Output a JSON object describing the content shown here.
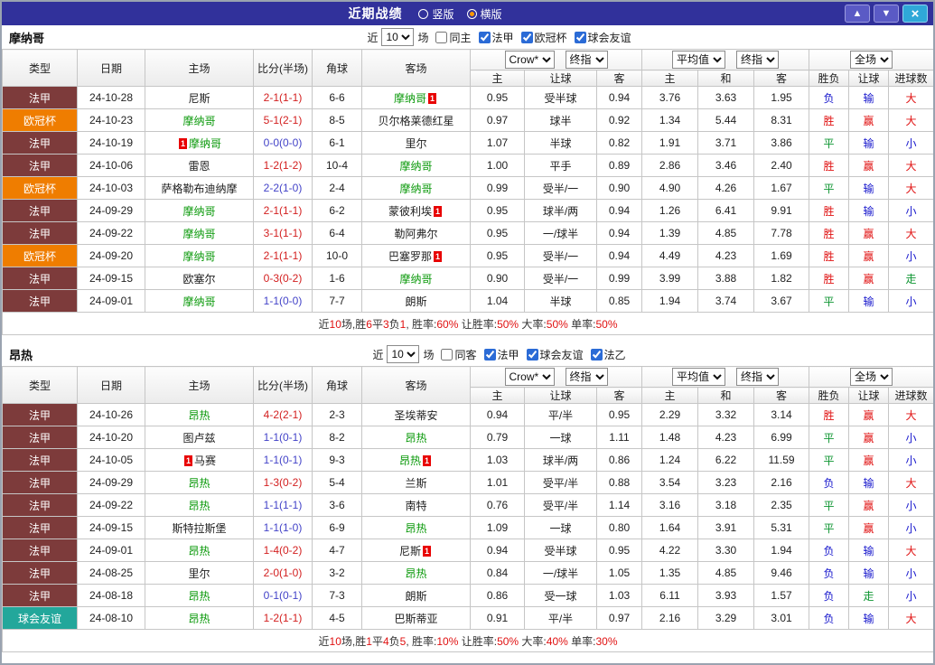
{
  "palette": {
    "leagues": {
      "法甲": "#7d3b3b",
      "欧冠杯": "#ef7d00",
      "球会友谊": "#23a79b"
    },
    "accent": "#31319b"
  },
  "titlebar": {
    "title": "近期战绩",
    "radio_vertical": "竖版",
    "radio_horizontal": "横版",
    "up_icon": "▲",
    "down_icon": "▼",
    "close_icon": "×"
  },
  "columns": {
    "left": [
      "类型",
      "日期",
      "主场",
      "比分(半场)",
      "角球",
      "客场"
    ],
    "odds_sub": [
      "主",
      "让球",
      "客"
    ],
    "avg_sub": [
      "主",
      "和",
      "客"
    ],
    "result_sub": [
      "胜负",
      "让球",
      "进球数"
    ],
    "odds_company": "Crow*",
    "odds_type": "终指",
    "avg_label": "平均值",
    "avg_type": "终指",
    "scope": "全场"
  },
  "teams": [
    {
      "name": "摩纳哥",
      "filters": {
        "near": "近",
        "count": "10",
        "games": "场",
        "same": "同主",
        "leagues": [
          "法甲",
          "欧冠杯",
          "球会友谊"
        ]
      },
      "rows": [
        {
          "league": "法甲",
          "date": "24-10-28",
          "home": {
            "name": "尼斯"
          },
          "score": "2-1(1-1)",
          "score_color": "r",
          "corner": "6-6",
          "away": {
            "name": "摩纳哥",
            "green": true,
            "card_after": "1"
          },
          "odds": [
            "0.95",
            "受半球",
            "0.94"
          ],
          "avg": [
            "3.76",
            "3.63",
            "1.95"
          ],
          "results": [
            {
              "t": "负",
              "c": "b"
            },
            {
              "t": "输",
              "c": "b"
            },
            {
              "t": "大",
              "c": "r"
            }
          ]
        },
        {
          "league": "欧冠杯",
          "date": "24-10-23",
          "home": {
            "name": "摩纳哥",
            "green": true
          },
          "score": "5-1(2-1)",
          "score_color": "r",
          "corner": "8-5",
          "away": {
            "name": "贝尔格莱德红星"
          },
          "odds": [
            "0.97",
            "球半",
            "0.92"
          ],
          "avg": [
            "1.34",
            "5.44",
            "8.31"
          ],
          "results": [
            {
              "t": "胜",
              "c": "r"
            },
            {
              "t": "赢",
              "c": "r"
            },
            {
              "t": "大",
              "c": "r"
            }
          ]
        },
        {
          "league": "法甲",
          "date": "24-10-19",
          "home": {
            "name": "摩纳哥",
            "green": true,
            "card_before": "1"
          },
          "score": "0-0(0-0)",
          "score_color": "b",
          "corner": "6-1",
          "away": {
            "name": "里尔"
          },
          "odds": [
            "1.07",
            "半球",
            "0.82"
          ],
          "avg": [
            "1.91",
            "3.71",
            "3.86"
          ],
          "results": [
            {
              "t": "平",
              "c": "g"
            },
            {
              "t": "输",
              "c": "b"
            },
            {
              "t": "小",
              "c": "b"
            }
          ]
        },
        {
          "league": "法甲",
          "date": "24-10-06",
          "home": {
            "name": "雷恩"
          },
          "score": "1-2(1-2)",
          "score_color": "r",
          "corner": "10-4",
          "away": {
            "name": "摩纳哥",
            "green": true
          },
          "odds": [
            "1.00",
            "平手",
            "0.89"
          ],
          "avg": [
            "2.86",
            "3.46",
            "2.40"
          ],
          "results": [
            {
              "t": "胜",
              "c": "r"
            },
            {
              "t": "赢",
              "c": "r"
            },
            {
              "t": "大",
              "c": "r"
            }
          ]
        },
        {
          "league": "欧冠杯",
          "date": "24-10-03",
          "home": {
            "name": "萨格勒布迪纳摩"
          },
          "score": "2-2(1-0)",
          "score_color": "b",
          "corner": "2-4",
          "away": {
            "name": "摩纳哥",
            "green": true
          },
          "odds": [
            "0.99",
            "受半/一",
            "0.90"
          ],
          "avg": [
            "4.90",
            "4.26",
            "1.67"
          ],
          "results": [
            {
              "t": "平",
              "c": "g"
            },
            {
              "t": "输",
              "c": "b"
            },
            {
              "t": "大",
              "c": "r"
            }
          ]
        },
        {
          "league": "法甲",
          "date": "24-09-29",
          "home": {
            "name": "摩纳哥",
            "green": true
          },
          "score": "2-1(1-1)",
          "score_color": "r",
          "corner": "6-2",
          "away": {
            "name": "蒙彼利埃",
            "card_after": "1"
          },
          "odds": [
            "0.95",
            "球半/两",
            "0.94"
          ],
          "avg": [
            "1.26",
            "6.41",
            "9.91"
          ],
          "results": [
            {
              "t": "胜",
              "c": "r"
            },
            {
              "t": "输",
              "c": "b"
            },
            {
              "t": "小",
              "c": "b"
            }
          ]
        },
        {
          "league": "法甲",
          "date": "24-09-22",
          "home": {
            "name": "摩纳哥",
            "green": true
          },
          "score": "3-1(1-1)",
          "score_color": "r",
          "corner": "6-4",
          "away": {
            "name": "勒阿弗尔"
          },
          "odds": [
            "0.95",
            "一/球半",
            "0.94"
          ],
          "avg": [
            "1.39",
            "4.85",
            "7.78"
          ],
          "results": [
            {
              "t": "胜",
              "c": "r"
            },
            {
              "t": "赢",
              "c": "r"
            },
            {
              "t": "大",
              "c": "r"
            }
          ]
        },
        {
          "league": "欧冠杯",
          "date": "24-09-20",
          "home": {
            "name": "摩纳哥",
            "green": true
          },
          "score": "2-1(1-1)",
          "score_color": "r",
          "corner": "10-0",
          "away": {
            "name": "巴塞罗那",
            "card_after": "1"
          },
          "odds": [
            "0.95",
            "受半/一",
            "0.94"
          ],
          "avg": [
            "4.49",
            "4.23",
            "1.69"
          ],
          "results": [
            {
              "t": "胜",
              "c": "r"
            },
            {
              "t": "赢",
              "c": "r"
            },
            {
              "t": "小",
              "c": "b"
            }
          ]
        },
        {
          "league": "法甲",
          "date": "24-09-15",
          "home": {
            "name": "欧塞尔"
          },
          "score": "0-3(0-2)",
          "score_color": "r",
          "corner": "1-6",
          "away": {
            "name": "摩纳哥",
            "green": true
          },
          "odds": [
            "0.90",
            "受半/一",
            "0.99"
          ],
          "avg": [
            "3.99",
            "3.88",
            "1.82"
          ],
          "results": [
            {
              "t": "胜",
              "c": "r"
            },
            {
              "t": "赢",
              "c": "r"
            },
            {
              "t": "走",
              "c": "g"
            }
          ]
        },
        {
          "league": "法甲",
          "date": "24-09-01",
          "home": {
            "name": "摩纳哥",
            "green": true
          },
          "score": "1-1(0-0)",
          "score_color": "b",
          "corner": "7-7",
          "away": {
            "name": "朗斯"
          },
          "odds": [
            "1.04",
            "半球",
            "0.85"
          ],
          "avg": [
            "1.94",
            "3.74",
            "3.67"
          ],
          "results": [
            {
              "t": "平",
              "c": "g"
            },
            {
              "t": "输",
              "c": "b"
            },
            {
              "t": "小",
              "c": "b"
            }
          ]
        }
      ],
      "summary": [
        {
          "t": "近"
        },
        {
          "t": "10",
          "c": "r"
        },
        {
          "t": "场,胜"
        },
        {
          "t": "6",
          "c": "r"
        },
        {
          "t": "平"
        },
        {
          "t": "3",
          "c": "r"
        },
        {
          "t": "负"
        },
        {
          "t": "1",
          "c": "r"
        },
        {
          "t": ", 胜率:"
        },
        {
          "t": "60%",
          "c": "r"
        },
        {
          "t": " 让胜率:"
        },
        {
          "t": "50%",
          "c": "r"
        },
        {
          "t": " 大率:"
        },
        {
          "t": "50%",
          "c": "r"
        },
        {
          "t": " 单率:"
        },
        {
          "t": "50%",
          "c": "r"
        }
      ]
    },
    {
      "name": "昂热",
      "filters": {
        "near": "近",
        "count": "10",
        "games": "场",
        "same": "同客",
        "leagues": [
          "法甲",
          "球会友谊",
          "法乙"
        ]
      },
      "rows": [
        {
          "league": "法甲",
          "date": "24-10-26",
          "home": {
            "name": "昂热",
            "green": true
          },
          "score": "4-2(2-1)",
          "score_color": "r",
          "corner": "2-3",
          "away": {
            "name": "圣埃蒂安"
          },
          "odds": [
            "0.94",
            "平/半",
            "0.95"
          ],
          "avg": [
            "2.29",
            "3.32",
            "3.14"
          ],
          "results": [
            {
              "t": "胜",
              "c": "r"
            },
            {
              "t": "赢",
              "c": "r"
            },
            {
              "t": "大",
              "c": "r"
            }
          ]
        },
        {
          "league": "法甲",
          "date": "24-10-20",
          "home": {
            "name": "图卢兹"
          },
          "score": "1-1(0-1)",
          "score_color": "b",
          "corner": "8-2",
          "away": {
            "name": "昂热",
            "green": true
          },
          "odds": [
            "0.79",
            "一球",
            "1.11"
          ],
          "avg": [
            "1.48",
            "4.23",
            "6.99"
          ],
          "results": [
            {
              "t": "平",
              "c": "g"
            },
            {
              "t": "赢",
              "c": "r"
            },
            {
              "t": "小",
              "c": "b"
            }
          ]
        },
        {
          "league": "法甲",
          "date": "24-10-05",
          "home": {
            "name": "马赛",
            "card_before": "1"
          },
          "score": "1-1(0-1)",
          "score_color": "b",
          "corner": "9-3",
          "away": {
            "name": "昂热",
            "green": true,
            "card_after": "1"
          },
          "odds": [
            "1.03",
            "球半/两",
            "0.86"
          ],
          "avg": [
            "1.24",
            "6.22",
            "11.59"
          ],
          "results": [
            {
              "t": "平",
              "c": "g"
            },
            {
              "t": "赢",
              "c": "r"
            },
            {
              "t": "小",
              "c": "b"
            }
          ]
        },
        {
          "league": "法甲",
          "date": "24-09-29",
          "home": {
            "name": "昂热",
            "green": true
          },
          "score": "1-3(0-2)",
          "score_color": "r",
          "corner": "5-4",
          "away": {
            "name": "兰斯"
          },
          "odds": [
            "1.01",
            "受平/半",
            "0.88"
          ],
          "avg": [
            "3.54",
            "3.23",
            "2.16"
          ],
          "results": [
            {
              "t": "负",
              "c": "b"
            },
            {
              "t": "输",
              "c": "b"
            },
            {
              "t": "大",
              "c": "r"
            }
          ]
        },
        {
          "league": "法甲",
          "date": "24-09-22",
          "home": {
            "name": "昂热",
            "green": true
          },
          "score": "1-1(1-1)",
          "score_color": "b",
          "corner": "3-6",
          "away": {
            "name": "南特"
          },
          "odds": [
            "0.76",
            "受平/半",
            "1.14"
          ],
          "avg": [
            "3.16",
            "3.18",
            "2.35"
          ],
          "results": [
            {
              "t": "平",
              "c": "g"
            },
            {
              "t": "赢",
              "c": "r"
            },
            {
              "t": "小",
              "c": "b"
            }
          ]
        },
        {
          "league": "法甲",
          "date": "24-09-15",
          "home": {
            "name": "斯特拉斯堡"
          },
          "score": "1-1(1-0)",
          "score_color": "b",
          "corner": "6-9",
          "away": {
            "name": "昂热",
            "green": true
          },
          "odds": [
            "1.09",
            "一球",
            "0.80"
          ],
          "avg": [
            "1.64",
            "3.91",
            "5.31"
          ],
          "results": [
            {
              "t": "平",
              "c": "g"
            },
            {
              "t": "赢",
              "c": "r"
            },
            {
              "t": "小",
              "c": "b"
            }
          ]
        },
        {
          "league": "法甲",
          "date": "24-09-01",
          "home": {
            "name": "昂热",
            "green": true
          },
          "score": "1-4(0-2)",
          "score_color": "r",
          "corner": "4-7",
          "away": {
            "name": "尼斯",
            "card_after": "1"
          },
          "odds": [
            "0.94",
            "受半球",
            "0.95"
          ],
          "avg": [
            "4.22",
            "3.30",
            "1.94"
          ],
          "results": [
            {
              "t": "负",
              "c": "b"
            },
            {
              "t": "输",
              "c": "b"
            },
            {
              "t": "大",
              "c": "r"
            }
          ]
        },
        {
          "league": "法甲",
          "date": "24-08-25",
          "home": {
            "name": "里尔"
          },
          "score": "2-0(1-0)",
          "score_color": "r",
          "corner": "3-2",
          "away": {
            "name": "昂热",
            "green": true
          },
          "odds": [
            "0.84",
            "一/球半",
            "1.05"
          ],
          "avg": [
            "1.35",
            "4.85",
            "9.46"
          ],
          "results": [
            {
              "t": "负",
              "c": "b"
            },
            {
              "t": "输",
              "c": "b"
            },
            {
              "t": "小",
              "c": "b"
            }
          ]
        },
        {
          "league": "法甲",
          "date": "24-08-18",
          "home": {
            "name": "昂热",
            "green": true
          },
          "score": "0-1(0-1)",
          "score_color": "b",
          "corner": "7-3",
          "away": {
            "name": "朗斯"
          },
          "odds": [
            "0.86",
            "受一球",
            "1.03"
          ],
          "avg": [
            "6.11",
            "3.93",
            "1.57"
          ],
          "results": [
            {
              "t": "负",
              "c": "b"
            },
            {
              "t": "走",
              "c": "g"
            },
            {
              "t": "小",
              "c": "b"
            }
          ]
        },
        {
          "league": "球会友谊",
          "date": "24-08-10",
          "home": {
            "name": "昂热",
            "green": true
          },
          "score": "1-2(1-1)",
          "score_color": "r",
          "corner": "4-5",
          "away": {
            "name": "巴斯蒂亚"
          },
          "odds": [
            "0.91",
            "平/半",
            "0.97"
          ],
          "avg": [
            "2.16",
            "3.29",
            "3.01"
          ],
          "results": [
            {
              "t": "负",
              "c": "b"
            },
            {
              "t": "输",
              "c": "b"
            },
            {
              "t": "大",
              "c": "r"
            }
          ]
        }
      ],
      "summary": [
        {
          "t": "近"
        },
        {
          "t": "10",
          "c": "r"
        },
        {
          "t": "场,胜"
        },
        {
          "t": "1",
          "c": "r"
        },
        {
          "t": "平"
        },
        {
          "t": "4",
          "c": "r"
        },
        {
          "t": "负"
        },
        {
          "t": "5",
          "c": "r"
        },
        {
          "t": ", 胜率:"
        },
        {
          "t": "10%",
          "c": "r"
        },
        {
          "t": " 让胜率:"
        },
        {
          "t": "50%",
          "c": "r"
        },
        {
          "t": " 大率:"
        },
        {
          "t": "40%",
          "c": "r"
        },
        {
          "t": " 单率:"
        },
        {
          "t": "30%",
          "c": "r"
        }
      ]
    }
  ]
}
